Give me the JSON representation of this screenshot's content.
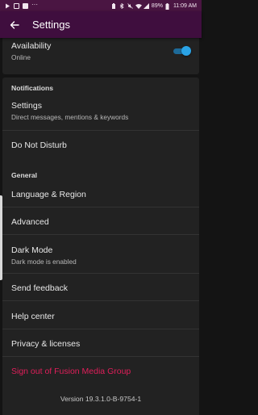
{
  "status_bar": {
    "left_icons": [
      "play-store-icon",
      "instagram-icon",
      "facebook-icon",
      "more-icon"
    ],
    "right_icons": [
      "battery-saver-icon",
      "bluetooth-icon",
      "mute-icon",
      "wifi-icon",
      "signal-icon"
    ],
    "battery": "89%",
    "time": "11:09 AM"
  },
  "header": {
    "title": "Settings"
  },
  "availability": {
    "label": "Availability",
    "value": "Online",
    "enabled": true
  },
  "notifications": {
    "section_label": "Notifications",
    "settings_label": "Settings",
    "settings_sub": "Direct messages, mentions & keywords",
    "dnd_label": "Do Not Disturb"
  },
  "general": {
    "section_label": "General",
    "language_label": "Language & Region",
    "advanced_label": "Advanced",
    "dark_mode_label": "Dark Mode",
    "dark_mode_sub": "Dark mode is enabled",
    "feedback_label": "Send feedback",
    "help_label": "Help center",
    "privacy_label": "Privacy & licenses",
    "signout_label": "Sign out of Fusion Media Group"
  },
  "footer": {
    "version": "Version 19.3.1.0-B-9754-1"
  },
  "colors": {
    "appbar": "#3f0e3e",
    "statusbar": "#4a1542",
    "background": "#141414",
    "card": "#222222",
    "toggle_on": "#2aa3e6",
    "danger": "#e01e5a"
  }
}
